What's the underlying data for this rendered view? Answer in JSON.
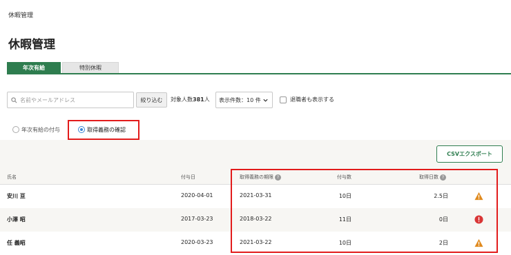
{
  "breadcrumb": "休暇管理",
  "page_title": "休暇管理",
  "tabs": [
    {
      "label": "年次有給",
      "active": true
    },
    {
      "label": "特別休暇",
      "active": false
    }
  ],
  "filters": {
    "search_placeholder": "名前やメールアドレス",
    "filter_button": "絞り込む",
    "target_label": "対象人数",
    "target_count": "381",
    "target_unit": "人",
    "per_page": "表示件数：10 件",
    "show_retired_label": "退職者も表示する"
  },
  "mode_radios": [
    {
      "label": "年次有給の付与",
      "selected": false
    },
    {
      "label": "取得義務の確認",
      "selected": true
    }
  ],
  "csv_export_label": "CSVエクスポート",
  "table": {
    "columns": {
      "name": "氏名",
      "grant_date": "付与日",
      "deadline": "取得義務の期限",
      "granted_days": "付与数",
      "taken_days": "取得日数"
    },
    "rows": [
      {
        "name": "安川 亘",
        "grant_date": "2020-04-01",
        "deadline": "2021-03-31",
        "granted_days": "10日",
        "taken_days": "2.5日",
        "status": "warning"
      },
      {
        "name": "小澤 昭",
        "grant_date": "2017-03-23",
        "deadline": "2018-03-22",
        "granted_days": "11日",
        "taken_days": "0日",
        "status": "error"
      },
      {
        "name": "任 義昭",
        "grant_date": "2020-03-23",
        "deadline": "2021-03-22",
        "granted_days": "10日",
        "taken_days": "2日",
        "status": "warning"
      }
    ]
  },
  "colors": {
    "accent_green": "#2e7d4f",
    "highlight_red": "#e21b1b",
    "warning_orange": "#e08a1e",
    "error_red": "#d93636",
    "radio_blue": "#3a86d6"
  },
  "icons": [
    "search-icon",
    "chevron-down-icon",
    "help-icon",
    "warning-icon",
    "error-icon"
  ]
}
